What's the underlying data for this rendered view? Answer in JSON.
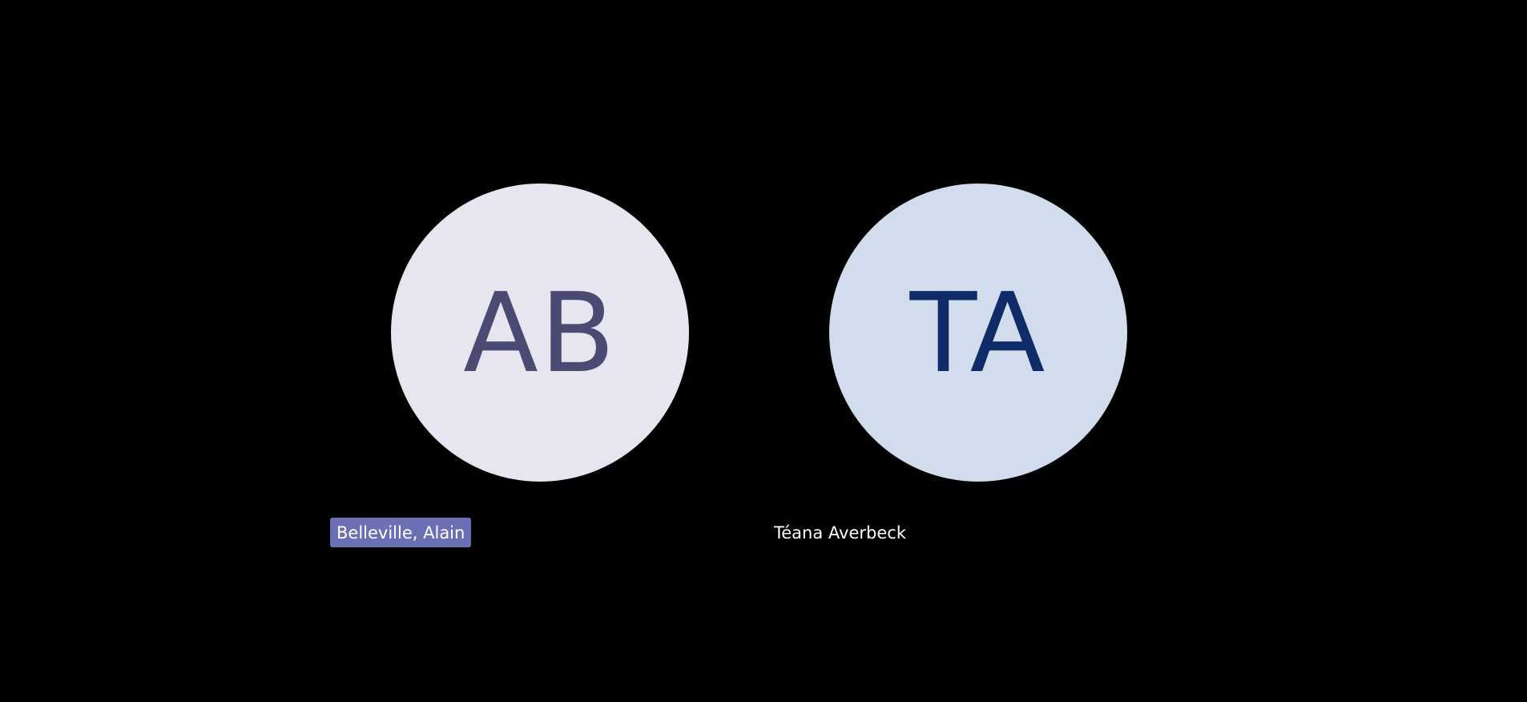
{
  "participants": [
    {
      "initials": "AB",
      "name": "Belleville, Alain",
      "avatar_bg": "#e6e5f0",
      "initials_color": "#4b4a72",
      "speaking": true,
      "label_bg": "#6b6fb3"
    },
    {
      "initials": "TA",
      "name": "Téana Averbeck",
      "avatar_bg": "#d1ddec",
      "initials_color": "#0f2c68",
      "speaking": false
    }
  ],
  "background": "#000000"
}
